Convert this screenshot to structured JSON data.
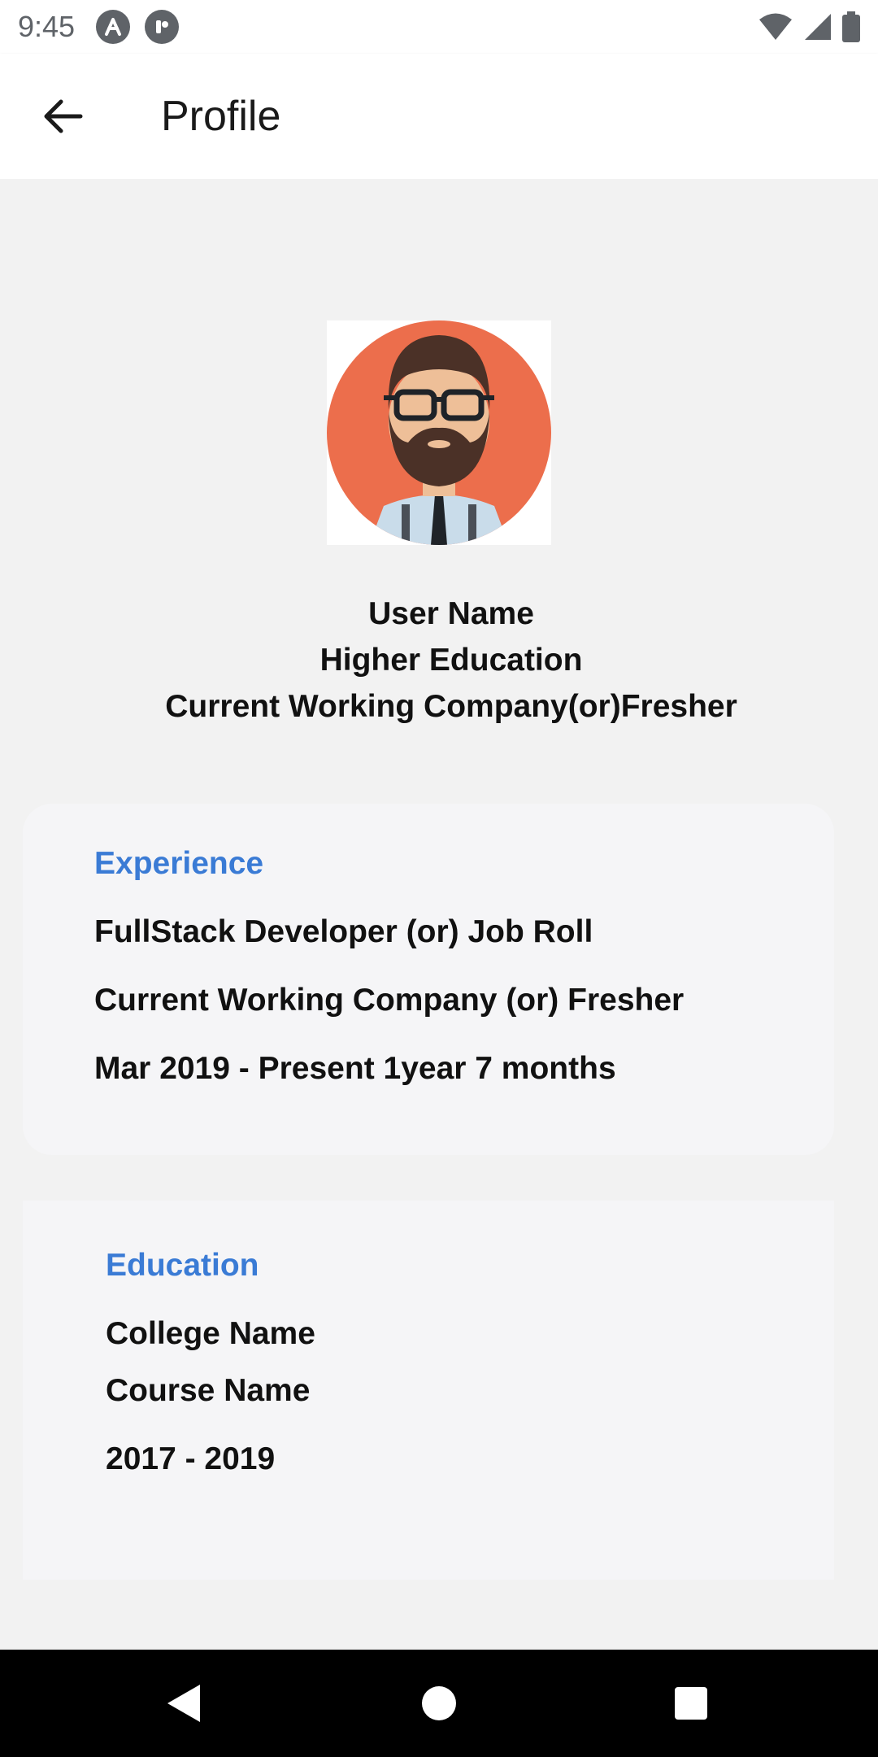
{
  "status_bar": {
    "time": "9:45",
    "icons": [
      "app-notification-icon",
      "app-notification-icon",
      "wifi-icon",
      "cellular-signal-icon",
      "battery-icon"
    ]
  },
  "app_bar": {
    "title": "Profile",
    "back_icon": "arrow-left-icon"
  },
  "profile": {
    "avatar_icon": "bearded-man-avatar",
    "user_name": "User Name",
    "education": "Higher Education",
    "company": "Current Working Company(or)Fresher"
  },
  "experience": {
    "heading": "Experience",
    "role": "FullStack Developer (or) Job Roll",
    "company": "Current Working Company (or) Fresher",
    "duration": "Mar 2019 - Present 1year 7 months"
  },
  "education": {
    "heading": "Education",
    "college": "College Name",
    "course": "Course Name",
    "years": "2017 - 2019"
  },
  "nav_bar": {
    "icons": [
      "back-triangle-icon",
      "home-circle-icon",
      "recents-square-icon"
    ]
  },
  "colors": {
    "accent": "#3a7bd5",
    "avatar_bg": "#ec6e4c",
    "card_bg": "#f5f5f7",
    "page_bg": "#f2f2f2"
  }
}
